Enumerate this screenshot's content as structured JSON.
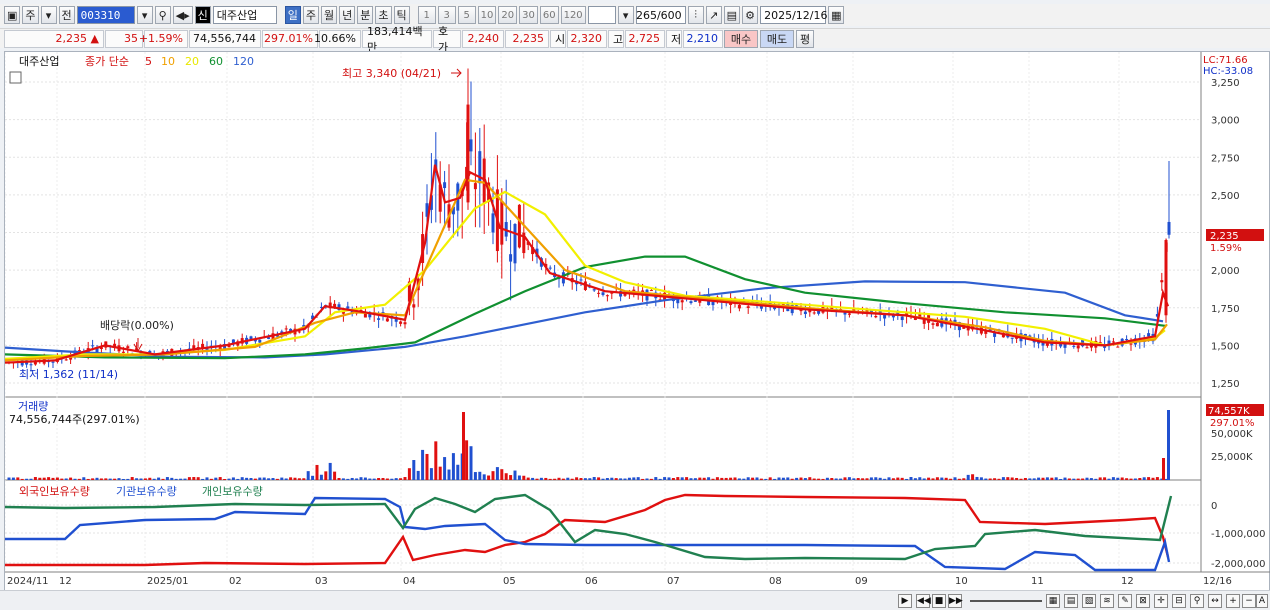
{
  "toolbar": {
    "market": "주",
    "prev": "전",
    "code": "003310",
    "name": "대주산업",
    "badge": "신",
    "periods": [
      "일",
      "주",
      "월",
      "년",
      "분",
      "초",
      "틱"
    ],
    "active_period": "일",
    "nums": [
      "1",
      "3",
      "5",
      "10",
      "20",
      "30",
      "60",
      "120"
    ],
    "count": "265",
    "count_total": "/600",
    "date": "2025/12/16"
  },
  "quote": {
    "price": "2,235",
    "arrow": "▲",
    "change": "35",
    "pct": "+1.59%",
    "volume": "74,556,744",
    "vol_ratio": "297.01%",
    "turnover": "10.66%",
    "amount": "183,414백만",
    "hoga_label": "호가",
    "ask": "2,240",
    "bid": "2,235",
    "open_label": "시",
    "open": "2,320",
    "high_label": "고",
    "high": "2,725",
    "low_label": "저",
    "low": "2,210",
    "buy": "매수",
    "sell": "매도",
    "avg": "평"
  },
  "price_panel": {
    "stock": "대주산업",
    "ma_label": "종가 단순",
    "ma": [
      {
        "p": "5",
        "color": "#d21010"
      },
      {
        "p": "10",
        "color": "#f0a000"
      },
      {
        "p": "20",
        "color": "#e8e800"
      },
      {
        "p": "60",
        "color": "#109030"
      },
      {
        "p": "120",
        "color": "#2f5fd0"
      }
    ],
    "lc": "LC:71.66",
    "hc": "HC:-33.08",
    "high_note": "최고 3,340 (04/21)",
    "low_note": "최저 1,362 (11/14)",
    "div_note": "배당락(0.00%)",
    "yticks": [
      "3,250",
      "3,000",
      "2,750",
      "2,500",
      "2,250",
      "2,000",
      "1,750",
      "1,500",
      "1,250"
    ],
    "last": "2,235",
    "last_pct": "1.59%"
  },
  "volume_panel": {
    "title": "거래량",
    "value": "74,556,744주(297.01%)",
    "last": "74,557K",
    "last_pct": "297.01%",
    "yticks": [
      "50,000K",
      "25,000K"
    ]
  },
  "holding_panel": {
    "legend": [
      {
        "label": "외국인보유수량",
        "color": "#d21010"
      },
      {
        "label": "기관보유수량",
        "color": "#2050d0"
      },
      {
        "label": "개인보유수량",
        "color": "#208050"
      }
    ],
    "yticks": [
      "0",
      "-1,000,000",
      "-2,000,000"
    ]
  },
  "xaxis": {
    "labels": [
      "2024/11",
      "12",
      "2025/01",
      "02",
      "03",
      "04",
      "05",
      "06",
      "07",
      "08",
      "09",
      "10",
      "11",
      "12"
    ],
    "right": "12/16"
  },
  "chart_data": {
    "type": "line",
    "title": "",
    "x": [
      "2024/11",
      "12",
      "2025/01",
      "02",
      "03",
      "04",
      "05",
      "06",
      "07",
      "08",
      "09",
      "10",
      "11",
      "12"
    ],
    "series": [
      {
        "name": "5",
        "values": [
          1380,
          1480,
          1420,
          1500,
          1650,
          2600,
          2250,
          1850,
          1800,
          1720,
          1690,
          1600,
          1500,
          2200
        ]
      },
      {
        "name": "120",
        "values": [
          1480,
          1430,
          1400,
          1410,
          1440,
          1550,
          1720,
          1850,
          1900,
          1930,
          1920,
          1820,
          1680,
          1660
        ]
      }
    ],
    "ylim": [
      1250,
      3300
    ]
  }
}
